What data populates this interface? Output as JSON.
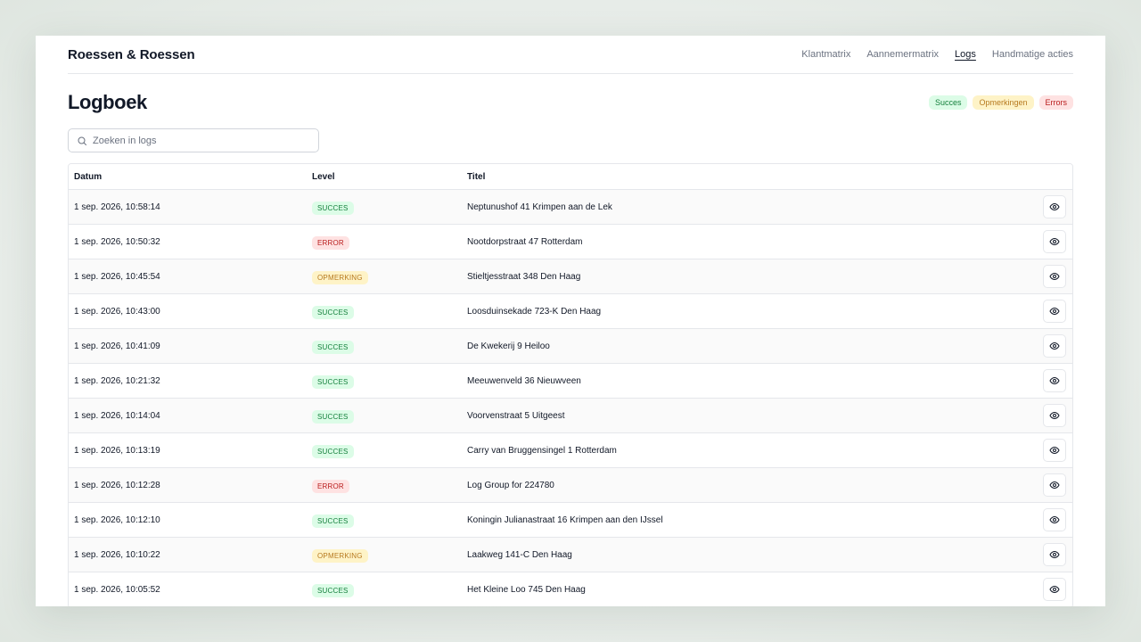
{
  "brand": "Roessen & Roessen",
  "nav": [
    {
      "label": "Klantmatrix",
      "active": false
    },
    {
      "label": "Aannemermatrix",
      "active": false
    },
    {
      "label": "Logs",
      "active": true
    },
    {
      "label": "Handmatige acties",
      "active": false
    }
  ],
  "page": {
    "title": "Logboek",
    "legend": {
      "succes": "Succes",
      "opmerkingen": "Opmerkingen",
      "errors": "Errors"
    }
  },
  "search": {
    "placeholder": "Zoeken in logs",
    "value": ""
  },
  "table": {
    "headers": {
      "date": "Datum",
      "level": "Level",
      "title": "Titel"
    },
    "rows": [
      {
        "date": "1 sep. 2026, 10:58:14",
        "level": "SUCCES",
        "title": "Neptunushof 41 Krimpen aan de Lek"
      },
      {
        "date": "1 sep. 2026, 10:50:32",
        "level": "ERROR",
        "title": "Nootdorpstraat 47 Rotterdam"
      },
      {
        "date": "1 sep. 2026, 10:45:54",
        "level": "OPMERKING",
        "title": "Stieltjesstraat 348 Den Haag"
      },
      {
        "date": "1 sep. 2026, 10:43:00",
        "level": "SUCCES",
        "title": "Loosduinsekade 723-K Den Haag"
      },
      {
        "date": "1 sep. 2026, 10:41:09",
        "level": "SUCCES",
        "title": "De Kwekerij 9 Heiloo"
      },
      {
        "date": "1 sep. 2026, 10:21:32",
        "level": "SUCCES",
        "title": "Meeuwenveld 36 Nieuwveen"
      },
      {
        "date": "1 sep. 2026, 10:14:04",
        "level": "SUCCES",
        "title": "Voorvenstraat 5 Uitgeest"
      },
      {
        "date": "1 sep. 2026, 10:13:19",
        "level": "SUCCES",
        "title": "Carry van Bruggensingel 1 Rotterdam"
      },
      {
        "date": "1 sep. 2026, 10:12:28",
        "level": "ERROR",
        "title": "Log Group for 224780"
      },
      {
        "date": "1 sep. 2026, 10:12:10",
        "level": "SUCCES",
        "title": "Koningin Julianastraat 16 Krimpen aan den IJssel"
      },
      {
        "date": "1 sep. 2026, 10:10:22",
        "level": "OPMERKING",
        "title": "Laakweg 141-C Den Haag"
      },
      {
        "date": "1 sep. 2026, 10:05:52",
        "level": "SUCCES",
        "title": "Het Kleine Loo 745 Den Haag"
      }
    ]
  },
  "colors": {
    "succes_bg": "#dcfce7",
    "succes_fg": "#15803d",
    "error_bg": "#fee2e2",
    "error_fg": "#b91c1c",
    "opmerking_bg": "#fef3c7",
    "opmerking_fg": "#b7791f"
  },
  "icons": {
    "search": "search-icon",
    "view": "eye-icon"
  }
}
